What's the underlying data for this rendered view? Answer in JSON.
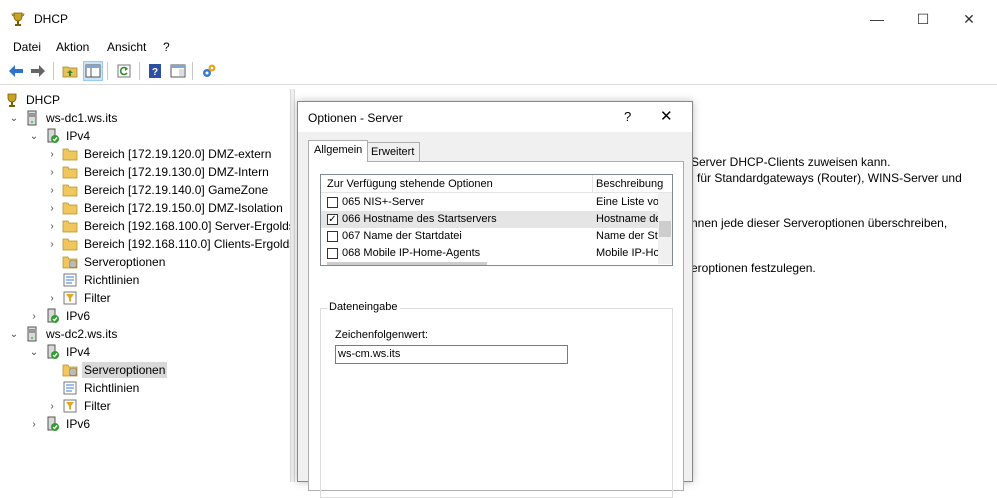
{
  "window": {
    "title": "DHCP",
    "minimize": "—",
    "maximize": "☐",
    "close": "✕"
  },
  "menu": {
    "items": [
      "Datei",
      "Aktion",
      "Ansicht",
      "?"
    ]
  },
  "tree": {
    "root": "DHCP",
    "nodes": [
      {
        "label": "ws-dc1.ws.its",
        "arrow": "⌄"
      },
      {
        "label": "IPv4",
        "arrow": "⌄"
      },
      {
        "label": "Bereich [172.19.120.0] DMZ-extern",
        "arrow": "›"
      },
      {
        "label": "Bereich [172.19.130.0] DMZ-Intern",
        "arrow": "›"
      },
      {
        "label": "Bereich [172.19.140.0] GameZone",
        "arrow": "›"
      },
      {
        "label": "Bereich [172.19.150.0] DMZ-Isolation",
        "arrow": "›"
      },
      {
        "label": "Bereich [192.168.100.0] Server-Ergoldsbach",
        "arrow": "›"
      },
      {
        "label": "Bereich [192.168.110.0] Clients-Ergoldsbach",
        "arrow": "›"
      },
      {
        "label": "Serveroptionen",
        "arrow": ""
      },
      {
        "label": "Richtlinien",
        "arrow": ""
      },
      {
        "label": "Filter",
        "arrow": "›"
      },
      {
        "label": "IPv6",
        "arrow": "›"
      },
      {
        "label": "ws-dc2.ws.its",
        "arrow": "⌄"
      },
      {
        "label": "IPv4",
        "arrow": "⌄"
      },
      {
        "label": "Serveroptionen",
        "arrow": ""
      },
      {
        "label": "Richtlinien",
        "arrow": ""
      },
      {
        "label": "Filter",
        "arrow": "›"
      },
      {
        "label": "IPv6",
        "arrow": "›"
      }
    ]
  },
  "right_pane": {
    "lines": [
      "Server DHCP-Clients zuweisen kann.",
      "für Standardgateways (Router), WINS-Server und",
      "nnen jede dieser Serveroptionen überschreiben,",
      "eroptionen festzulegen."
    ]
  },
  "dialog": {
    "title": "Optionen - Server",
    "help": "?",
    "close": "✕",
    "tabs": [
      "Allgemein",
      "Erweitert"
    ],
    "list_headers": [
      "Zur Verfügung stehende Optionen",
      "Beschreibung"
    ],
    "rows": [
      {
        "name": "065 NIS+-Server",
        "desc": "Eine Liste vo",
        "checked": false
      },
      {
        "name": "066 Hostname des Startservers",
        "desc": "Hostname de",
        "checked": true
      },
      {
        "name": "067 Name der Startdatei",
        "desc": "Name der Sta",
        "checked": false
      },
      {
        "name": "068 Mobile IP-Home-Agents",
        "desc": "Mobile IP-Ho",
        "checked": false
      }
    ],
    "group_label": "Dateneingabe",
    "field_label": "Zeichenfolgenwert:",
    "field_value": "ws-cm.ws.its"
  }
}
